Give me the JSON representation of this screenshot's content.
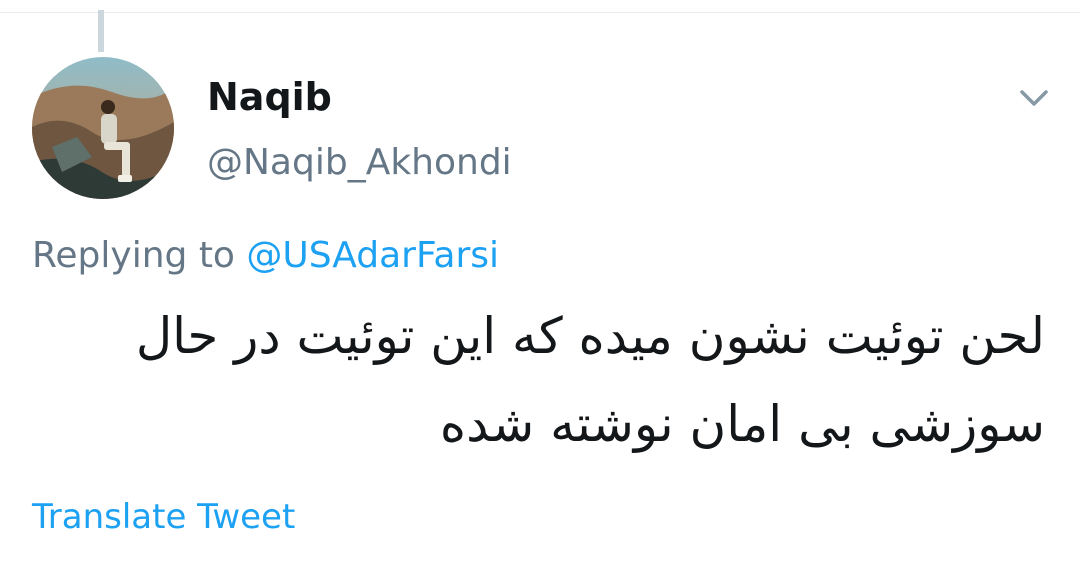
{
  "tweet": {
    "author": {
      "display_name": "Naqib",
      "handle": "@Naqib_Akhondi",
      "avatar_icon": "user-avatar-photo"
    },
    "menu_icon": "chevron-down-icon",
    "reply_context": {
      "prefix": "Replying to ",
      "mention": "@USAdarFarsi"
    },
    "text": "لحن توئیت نشون میده که این توئیت در حال سوزشی بی امان نوشته شده",
    "translate_label": "Translate Tweet"
  },
  "colors": {
    "text_primary": "#14171a",
    "text_secondary": "#657786",
    "accent": "#1da1f2",
    "thread_line": "#ccd6dd"
  }
}
